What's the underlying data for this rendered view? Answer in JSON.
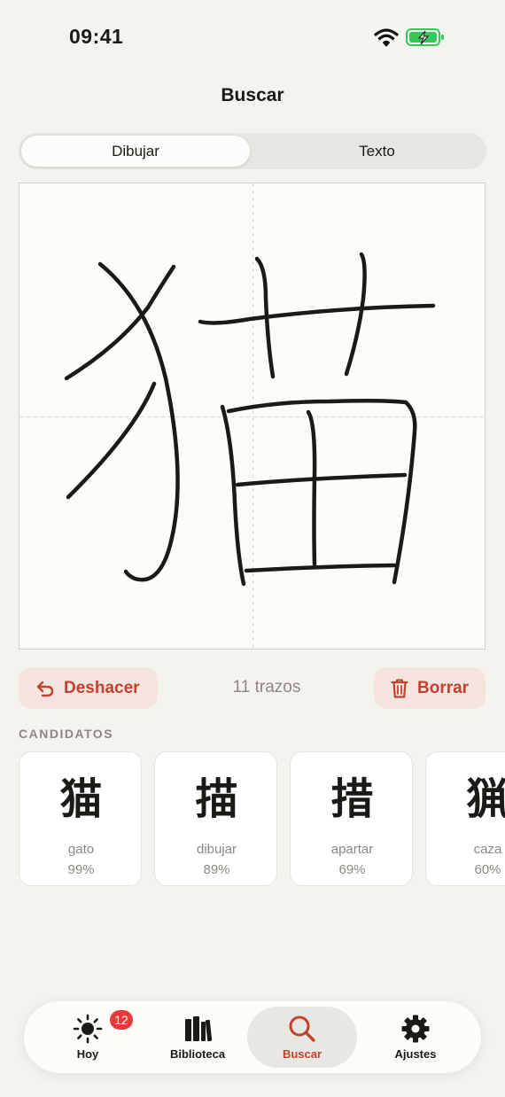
{
  "status_bar": {
    "time": "09:41",
    "wifi_icon": "wifi-icon",
    "battery_icon": "battery-charging-icon"
  },
  "nav": {
    "title": "Buscar"
  },
  "segments": {
    "draw": "Dibujar",
    "text": "Texto",
    "selected": "Dibujar"
  },
  "canvas": {
    "description_icon": "handwriting-canvas"
  },
  "controls": {
    "undo_label": "Deshacer",
    "stroke_count": "11 trazos",
    "clear_label": "Borrar"
  },
  "candidates_label": "CANDIDATOS",
  "candidates": [
    {
      "kanji": "猫",
      "meaning": "gato",
      "confidence": "99%"
    },
    {
      "kanji": "描",
      "meaning": "dibujar",
      "confidence": "89%"
    },
    {
      "kanji": "措",
      "meaning": "apartar",
      "confidence": "69%"
    },
    {
      "kanji": "猟",
      "meaning": "caza",
      "confidence": "60%"
    }
  ],
  "tabs": [
    {
      "label": "Hoy",
      "icon": "sun-icon",
      "badge": "12"
    },
    {
      "label": "Biblioteca",
      "icon": "books-icon"
    },
    {
      "label": "Buscar",
      "icon": "search-icon",
      "active": true
    },
    {
      "label": "Ajustes",
      "icon": "gear-icon"
    }
  ],
  "colors": {
    "accent": "#c2412f",
    "background": "#f5f3ee",
    "badge": "#e5393a",
    "battery": "#34c759"
  }
}
